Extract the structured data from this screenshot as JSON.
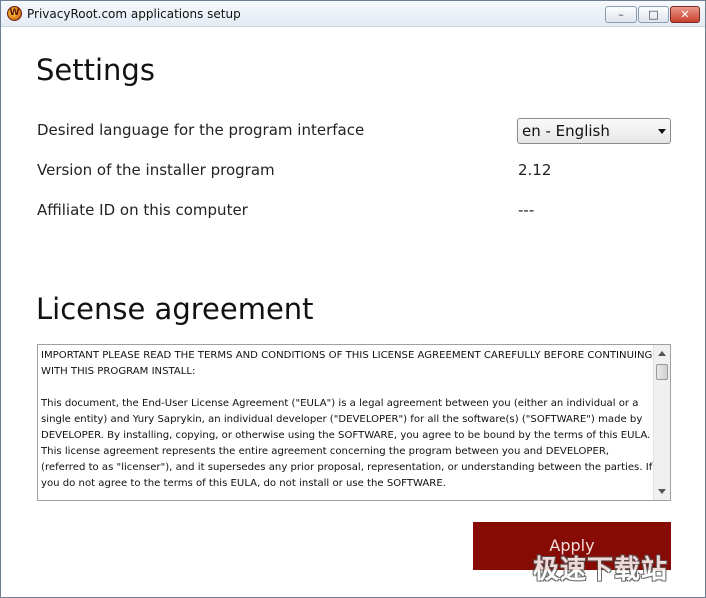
{
  "window": {
    "title": "PrivacyRoot.com applications setup",
    "controls": {
      "minimize": "–",
      "maximize": "□",
      "close": "✕"
    },
    "icon": "privacyroot-logo-icon"
  },
  "settings": {
    "heading": "Settings",
    "rows": [
      {
        "label": "Desired language for the program interface",
        "value": "en - English"
      },
      {
        "label": "Version of the installer program",
        "value": "2.12"
      },
      {
        "label": "Affiliate ID on this computer",
        "value": "---"
      }
    ]
  },
  "license": {
    "heading": "License agreement",
    "paragraphs": [
      "IMPORTANT PLEASE READ THE TERMS AND CONDITIONS OF THIS LICENSE AGREEMENT CAREFULLY BEFORE CONTINUING WITH THIS PROGRAM INSTALL:",
      "",
      "This document, the End-User License Agreement (\"EULA\") is a legal agreement between you (either an individual or a single entity) and Yury Saprykin, an individual developer (\"DEVELOPER\") for all the software(s) (\"SOFTWARE\") made by DEVELOPER. By installing, copying, or otherwise using the SOFTWARE, you agree to be bound by the terms of this EULA. This license agreement represents the entire agreement concerning the program between you and DEVELOPER, (referred to as \"licenser\"), and it supersedes any prior proposal, representation, or understanding between the parties. If you do not agree to the terms of this EULA, do not install or use the SOFTWARE."
    ]
  },
  "actions": {
    "apply_label": "Apply"
  },
  "watermark": "极速下载站",
  "colors": {
    "apply_bg": "#870b05",
    "window_border": "#6e7f93"
  }
}
